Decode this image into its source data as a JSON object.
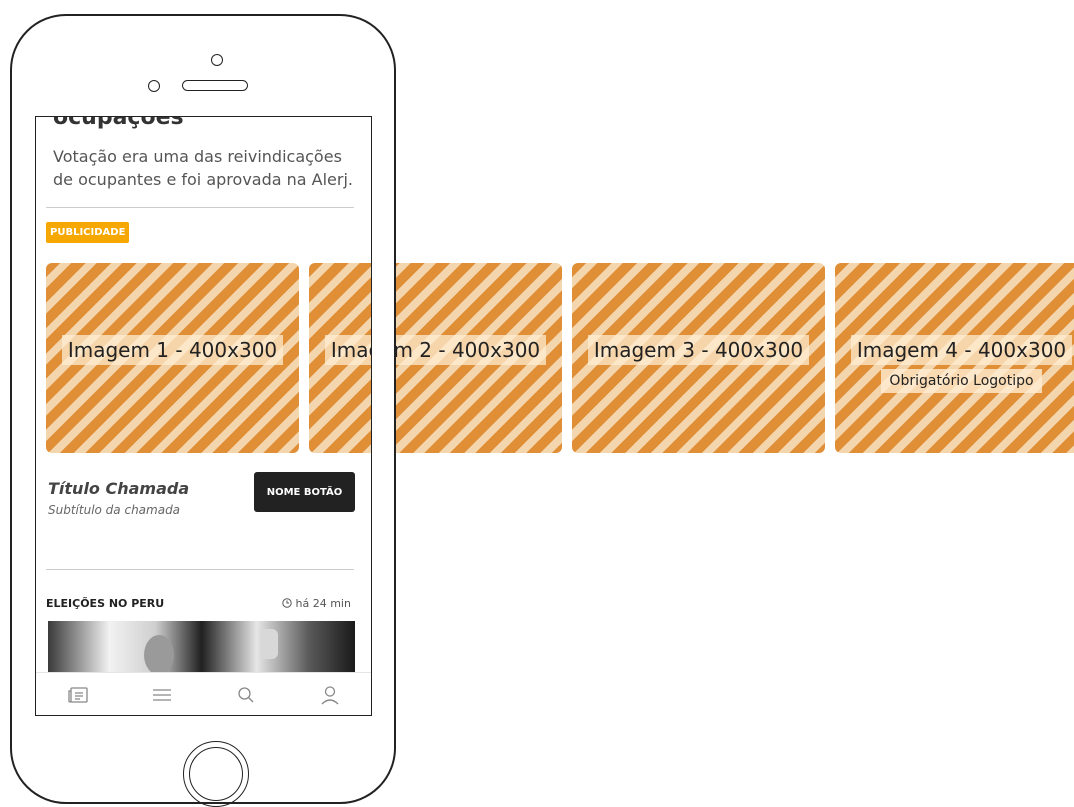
{
  "article": {
    "title": "ocupações",
    "summary": "Votação era uma das reivindicações de ocupantes e foi aprovada na Alerj."
  },
  "ad": {
    "badge": "PUBLICIDADE",
    "slides": [
      {
        "label": "Imagem 1 - 400x300"
      },
      {
        "label": "Imagem 2 - 400x300"
      },
      {
        "label": "Imagem 3 - 400x300"
      },
      {
        "label": "Imagem 4 - 400x300",
        "note": "Obrigatório Logotipo"
      }
    ],
    "colors": {
      "stripe_dark": "#e08f37",
      "stripe_light": "#f4d6ae",
      "badge": "#f6a800"
    }
  },
  "cta": {
    "title": "Título Chamada",
    "subtitle": "Subtítulo da chamada",
    "button_label": "NOME BOTÃO"
  },
  "section": {
    "title": "ELEIÇÕES NO PERU",
    "time": "há 24 min",
    "time_icon": "clock-icon"
  },
  "tabbar": {
    "items": [
      {
        "icon": "news-icon"
      },
      {
        "icon": "menu-icon"
      },
      {
        "icon": "search-icon"
      },
      {
        "icon": "user-icon"
      }
    ]
  }
}
